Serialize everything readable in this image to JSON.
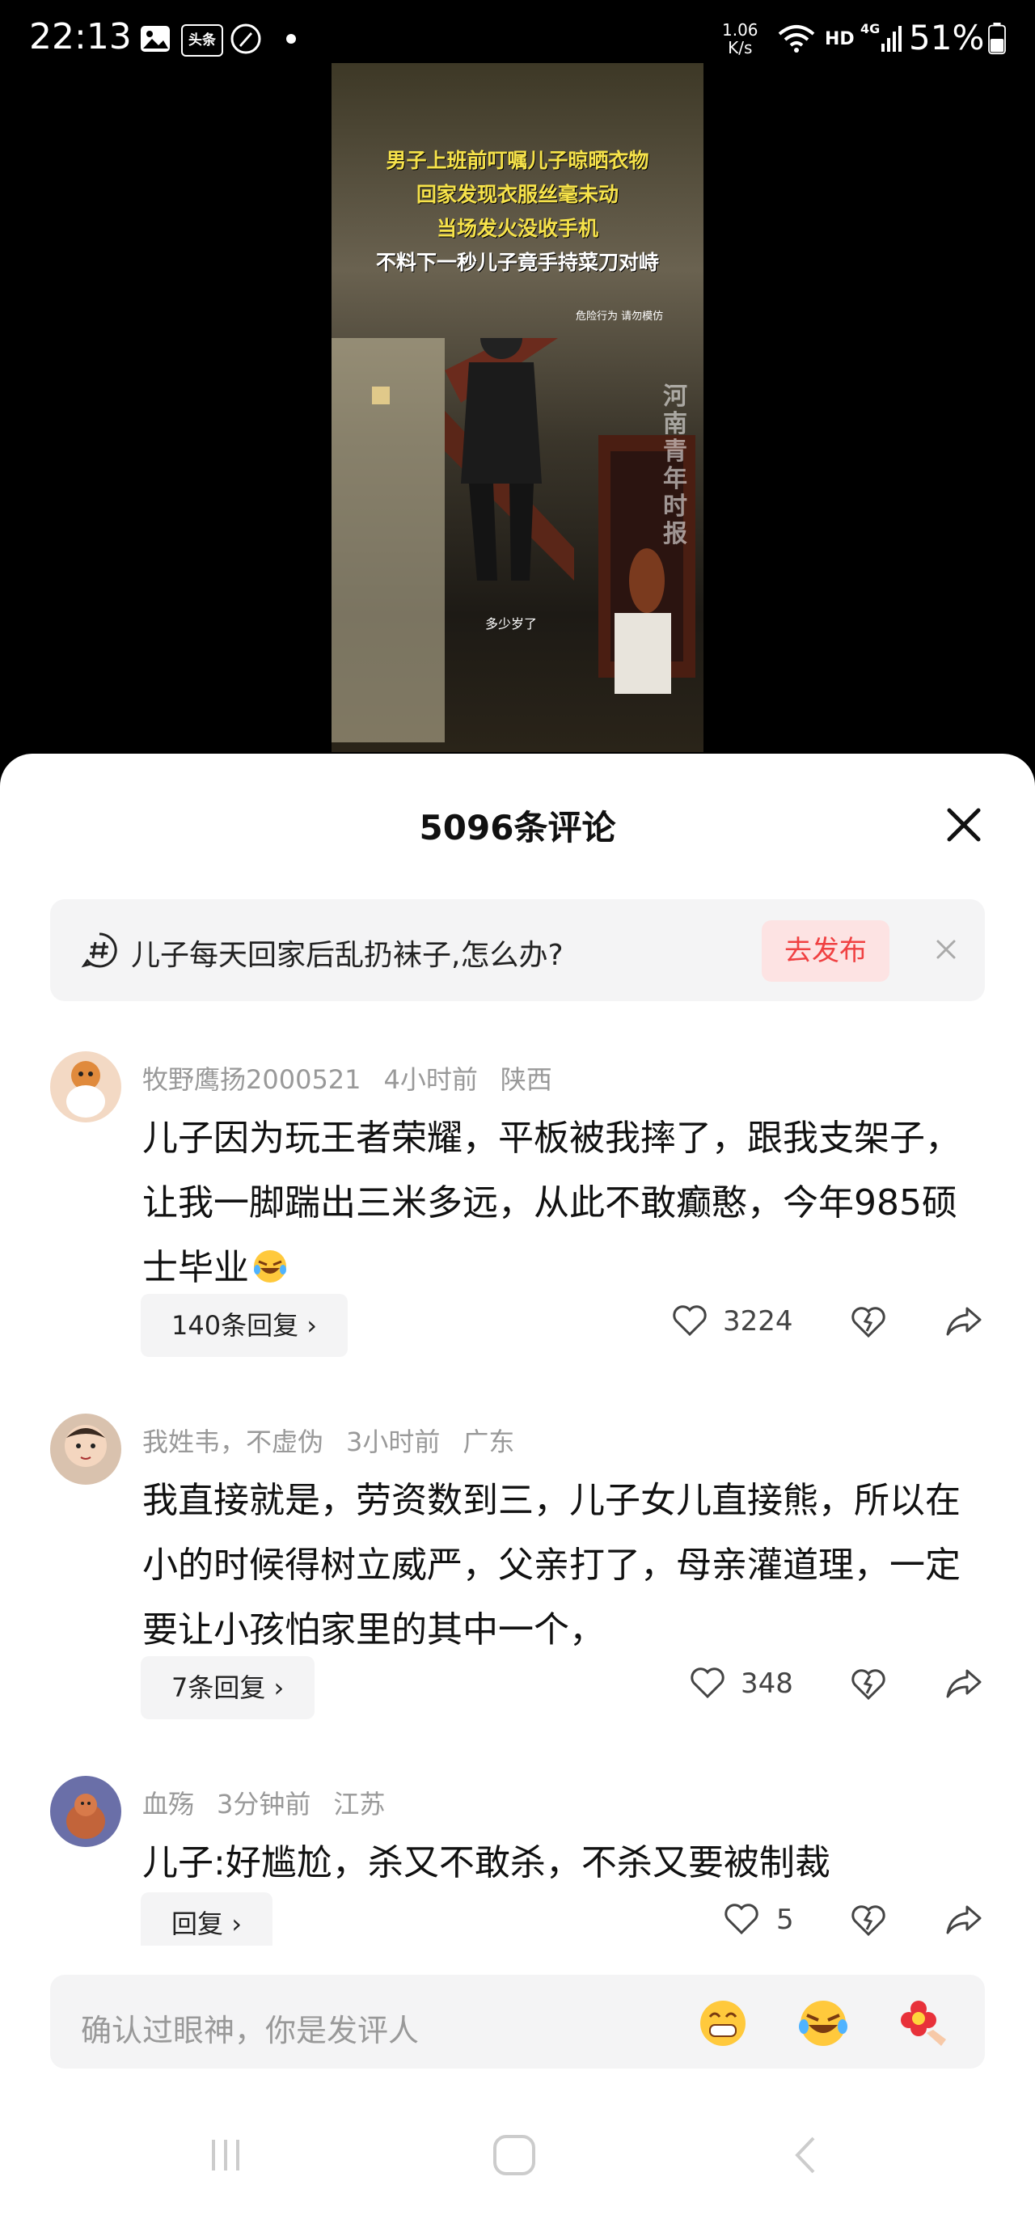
{
  "status_bar": {
    "time": "22:13",
    "app_badge": "头条",
    "net_speed_value": "1.06",
    "net_speed_unit": "K/s",
    "hd": "HD",
    "signal": "4G",
    "battery": "51%"
  },
  "video": {
    "caption_lines": [
      "男子上班前叮嘱儿子晾晒衣物",
      "回家发现衣服丝毫未动",
      "当场发火没收手机",
      "不料下一秒儿子竟手持菜刀对峙"
    ],
    "warning": "危险行为 请勿模仿",
    "watermark": "河南青年时报",
    "subtitle": "多少岁了"
  },
  "sheet": {
    "title": "5096条评论",
    "prompt_text": "儿子每天回家后乱扔袜子,怎么办?",
    "publish_label": "去发布"
  },
  "comments": [
    {
      "user": "牧野鹰扬2000521",
      "time": "4小时前",
      "location": "陕西",
      "text": "儿子因为玩王者荣耀，平板被我摔了，跟我支架子，让我一脚踹出三米多远，从此不敢癫憨，今年985硕士毕业",
      "replies": "140条回复",
      "likes": "3224"
    },
    {
      "user": "我姓韦，不虚伪",
      "time": "3小时前",
      "location": "广东",
      "text": "我直接就是，劳资数到三，儿子女儿直接熊，所以在小的时候得树立威严，父亲打了，母亲灌道理，一定要让小孩怕家里的其中一个，",
      "replies": "7条回复",
      "likes": "348"
    },
    {
      "user": "血殇",
      "time": "3分钟前",
      "location": "江苏",
      "text": "儿子:好尴尬，杀又不敢杀，不杀又要被制裁",
      "replies": "回复",
      "likes": "5"
    }
  ],
  "input": {
    "placeholder": "确认过眼神，你是发评人"
  },
  "icons": [
    "gallery-icon",
    "toutiao-icon",
    "rocket-icon",
    "wifi-icon",
    "signal-icon",
    "battery-icon",
    "close-icon",
    "hashtag-icon",
    "like-icon",
    "dislike-icon",
    "share-icon",
    "emoji-grin-icon",
    "emoji-laugh-cry-icon",
    "emoji-flower-icon",
    "nav-recents-icon",
    "nav-home-icon",
    "nav-back-icon"
  ]
}
